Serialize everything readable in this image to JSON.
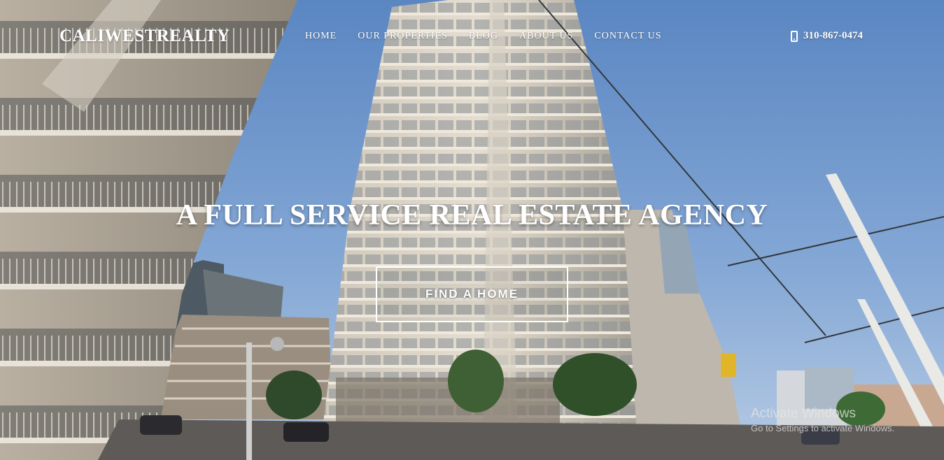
{
  "brand": {
    "name": "CALIWESTREALTY"
  },
  "nav": {
    "items": [
      {
        "label": "HOME"
      },
      {
        "label": "OUR PROPERTIES"
      },
      {
        "label": "BLOG"
      },
      {
        "label": "ABOUT US"
      },
      {
        "label": "CONTACT US"
      }
    ],
    "phone": "310-867-0474",
    "phone_icon": "mobile-phone-icon"
  },
  "hero": {
    "headline": "A FULL SERVICE REAL ESTATE AGENCY",
    "cta_label": "FIND A HOME",
    "background": "city-street-high-rise-buildings-photo"
  },
  "system_overlay": {
    "title": "Activate Windows",
    "subtitle": "Go to Settings to activate Windows."
  },
  "colors": {
    "sky": "#6d93c4",
    "text": "#ffffff"
  }
}
